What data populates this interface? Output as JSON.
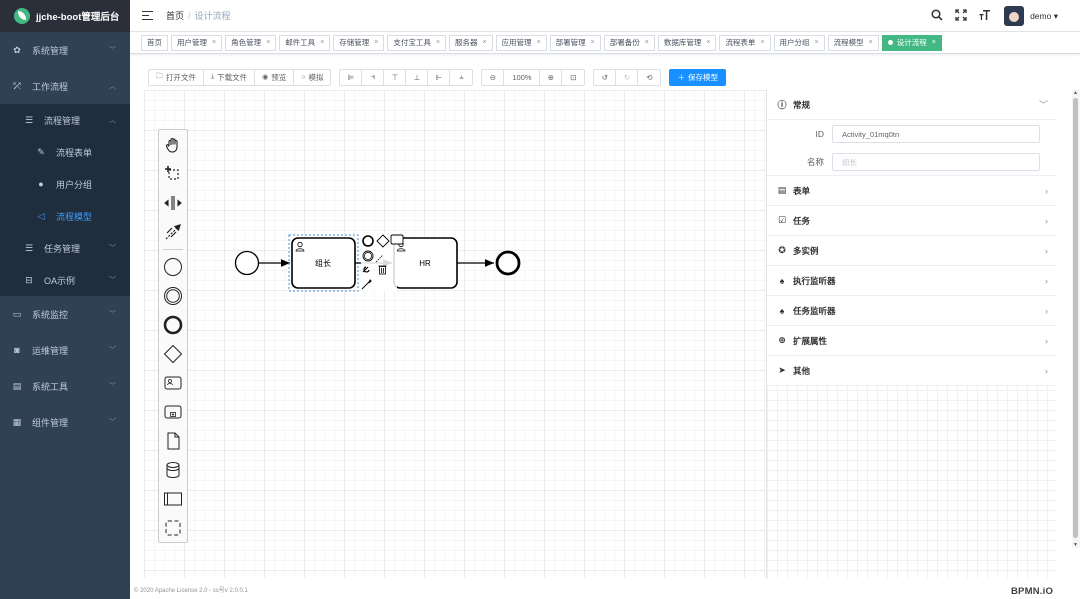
{
  "app": {
    "title": "jjche-boot管理后台"
  },
  "sidebar": {
    "items": [
      {
        "label": "系统管理"
      },
      {
        "label": "工作流程"
      },
      {
        "label": "流程管理"
      },
      {
        "label": "流程表单"
      },
      {
        "label": "用户分组"
      },
      {
        "label": "流程模型"
      },
      {
        "label": "任务管理"
      },
      {
        "label": "OA示例"
      },
      {
        "label": "系统监控"
      },
      {
        "label": "运维管理"
      },
      {
        "label": "系统工具"
      },
      {
        "label": "组件管理"
      }
    ]
  },
  "header": {
    "breadcrumb_home": "首页",
    "breadcrumb_current": "设计流程",
    "username": "demo",
    "user_caret": "▾"
  },
  "tags": [
    "首页",
    "用户管理",
    "角色管理",
    "邮件工具",
    "存储管理",
    "支付宝工具",
    "服务器",
    "应用管理",
    "部署管理",
    "部署备份",
    "数据库管理",
    "流程表单",
    "用户分组",
    "流程模型",
    "设计流程"
  ],
  "toolbar": {
    "open_file": "打开文件",
    "download_file": "下载文件",
    "preview": "预览",
    "simulate": "模拟",
    "zoom": "100%",
    "save": "保存模型"
  },
  "diagram": {
    "task1": "组长",
    "task2": "HR"
  },
  "panel": {
    "general": {
      "title": "常规",
      "id_label": "ID",
      "id_value": "Activity_01mq0tn",
      "name_label": "名称",
      "name_placeholder": "组长"
    },
    "sections": [
      "表单",
      "任务",
      "多实例",
      "执行监听器",
      "任务监听器",
      "扩展属性",
      "其他"
    ]
  },
  "footer": {
    "text": "© 2020 Apache License 2.0 - ss号v 2.0.0.1"
  },
  "brand": {
    "bpmn": "BPMN.iO"
  },
  "colors": {
    "sidebar": "#304156",
    "accent": "#409eff",
    "tag_active": "#42b983",
    "save": "#1890ff"
  }
}
